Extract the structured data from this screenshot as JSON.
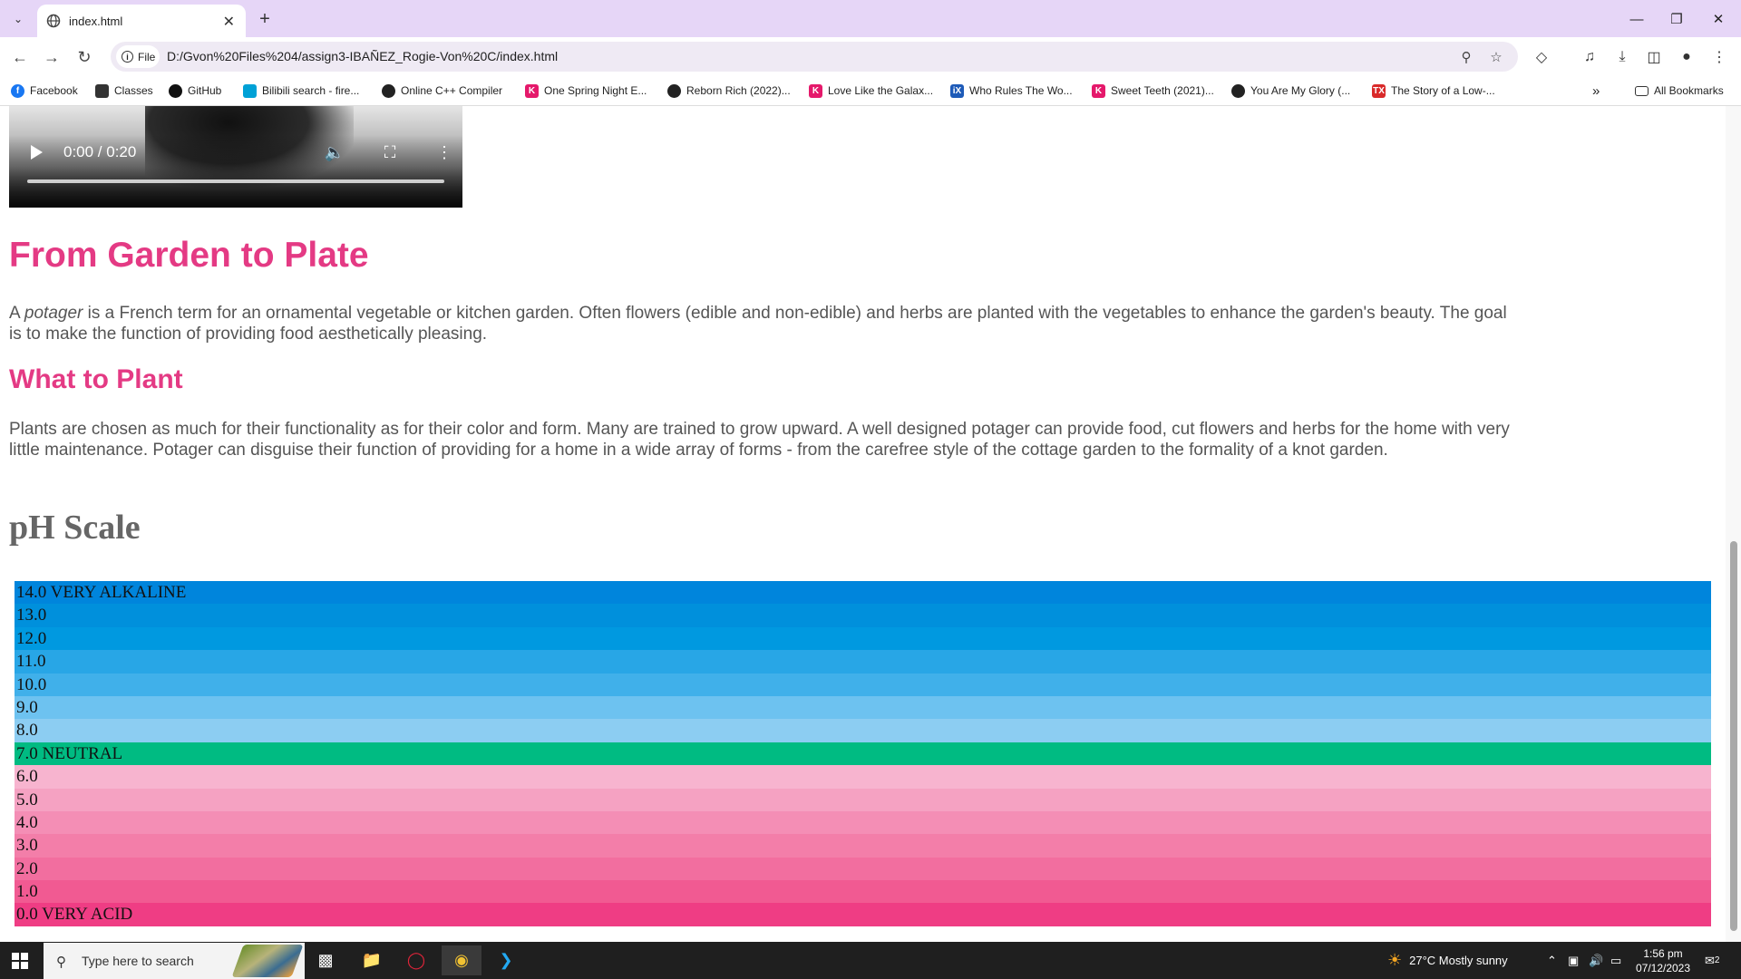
{
  "browser": {
    "tab_title": "index.html",
    "address_chip": "File",
    "url": "D:/Gvon%20Files%204/assign3-IBAÑEZ_Rogie-Von%20C/index.html",
    "bookmarks": [
      {
        "label": "Facebook",
        "icon": "facebook-icon",
        "color": "#1877f2"
      },
      {
        "label": "Classes",
        "icon": "classes-icon",
        "color": "#333333"
      },
      {
        "label": "GitHub",
        "icon": "github-icon",
        "color": "#111111"
      },
      {
        "label": "Bilibili search - fire...",
        "icon": "bilibili-icon",
        "color": "#00a1d6"
      },
      {
        "label": "Online C++ Compiler",
        "icon": "globe-icon",
        "color": "#222222"
      },
      {
        "label": "One Spring Night E...",
        "icon": "kissasian-icon",
        "color": "#e5196b"
      },
      {
        "label": "Reborn Rich (2022)...",
        "icon": "globe-icon",
        "color": "#222222"
      },
      {
        "label": "Love Like the Galax...",
        "icon": "kissasian-icon",
        "color": "#e5196b"
      },
      {
        "label": "Who Rules The Wo...",
        "icon": "iq-icon",
        "color": "#1e5bb8"
      },
      {
        "label": "Sweet Teeth (2021)...",
        "icon": "kissasian-icon",
        "color": "#e5196b"
      },
      {
        "label": "You Are My Glory (...",
        "icon": "globe-icon",
        "color": "#222222"
      },
      {
        "label": "The Story of a Low-...",
        "icon": "tx-icon",
        "color": "#d92a2a"
      }
    ],
    "all_bookmarks": "All Bookmarks"
  },
  "video": {
    "time": "0:00 / 0:20"
  },
  "content": {
    "h1": "From Garden to Plate",
    "p1_em": "potager",
    "p1_pre": "A ",
    "p1_post": " is a French term for an ornamental vegetable or kitchen garden. Often flowers (edible and non-edible) and herbs are planted with the vegetables to enhance the garden's beauty. The goal is to make the function of providing food aesthetically pleasing.",
    "h2": "What to Plant",
    "p2": "Plants are chosen as much for their functionality as for their color and form. Many are trained to grow upward. A well designed potager can provide food, cut flowers and herbs for the home with very little maintenance. Potager can disguise their function of providing for a home in a wide array of forms - from the carefree style of the cottage garden to the formality of a knot garden.",
    "ph_heading": "pH Scale"
  },
  "ph_scale": [
    {
      "label": "14.0 VERY ALKALINE",
      "color": "#0085dc"
    },
    {
      "label": "13.0",
      "color": "#0090dc"
    },
    {
      "label": "12.0",
      "color": "#0099e0"
    },
    {
      "label": "11.0",
      "color": "#28a6e6"
    },
    {
      "label": "10.0",
      "color": "#40b0ea"
    },
    {
      "label": "9.0",
      "color": "#6dc2f0"
    },
    {
      "label": "8.0",
      "color": "#8ccdf2"
    },
    {
      "label": "7.0 NEUTRAL",
      "color": "#00bb82"
    },
    {
      "label": "6.0",
      "color": "#f7b4cf"
    },
    {
      "label": "5.0",
      "color": "#f5a2c2"
    },
    {
      "label": "4.0",
      "color": "#f48eb5"
    },
    {
      "label": "3.0",
      "color": "#f37ea9"
    },
    {
      "label": "2.0",
      "color": "#f26e9f"
    },
    {
      "label": "1.0",
      "color": "#f15a92"
    },
    {
      "label": "0.0 VERY ACID",
      "color": "#ef3d84"
    }
  ],
  "taskbar": {
    "search_placeholder": "Type here to search",
    "weather": "27°C  Mostly sunny",
    "time": "1:56 pm",
    "date": "07/12/2023",
    "notifications": "2"
  }
}
